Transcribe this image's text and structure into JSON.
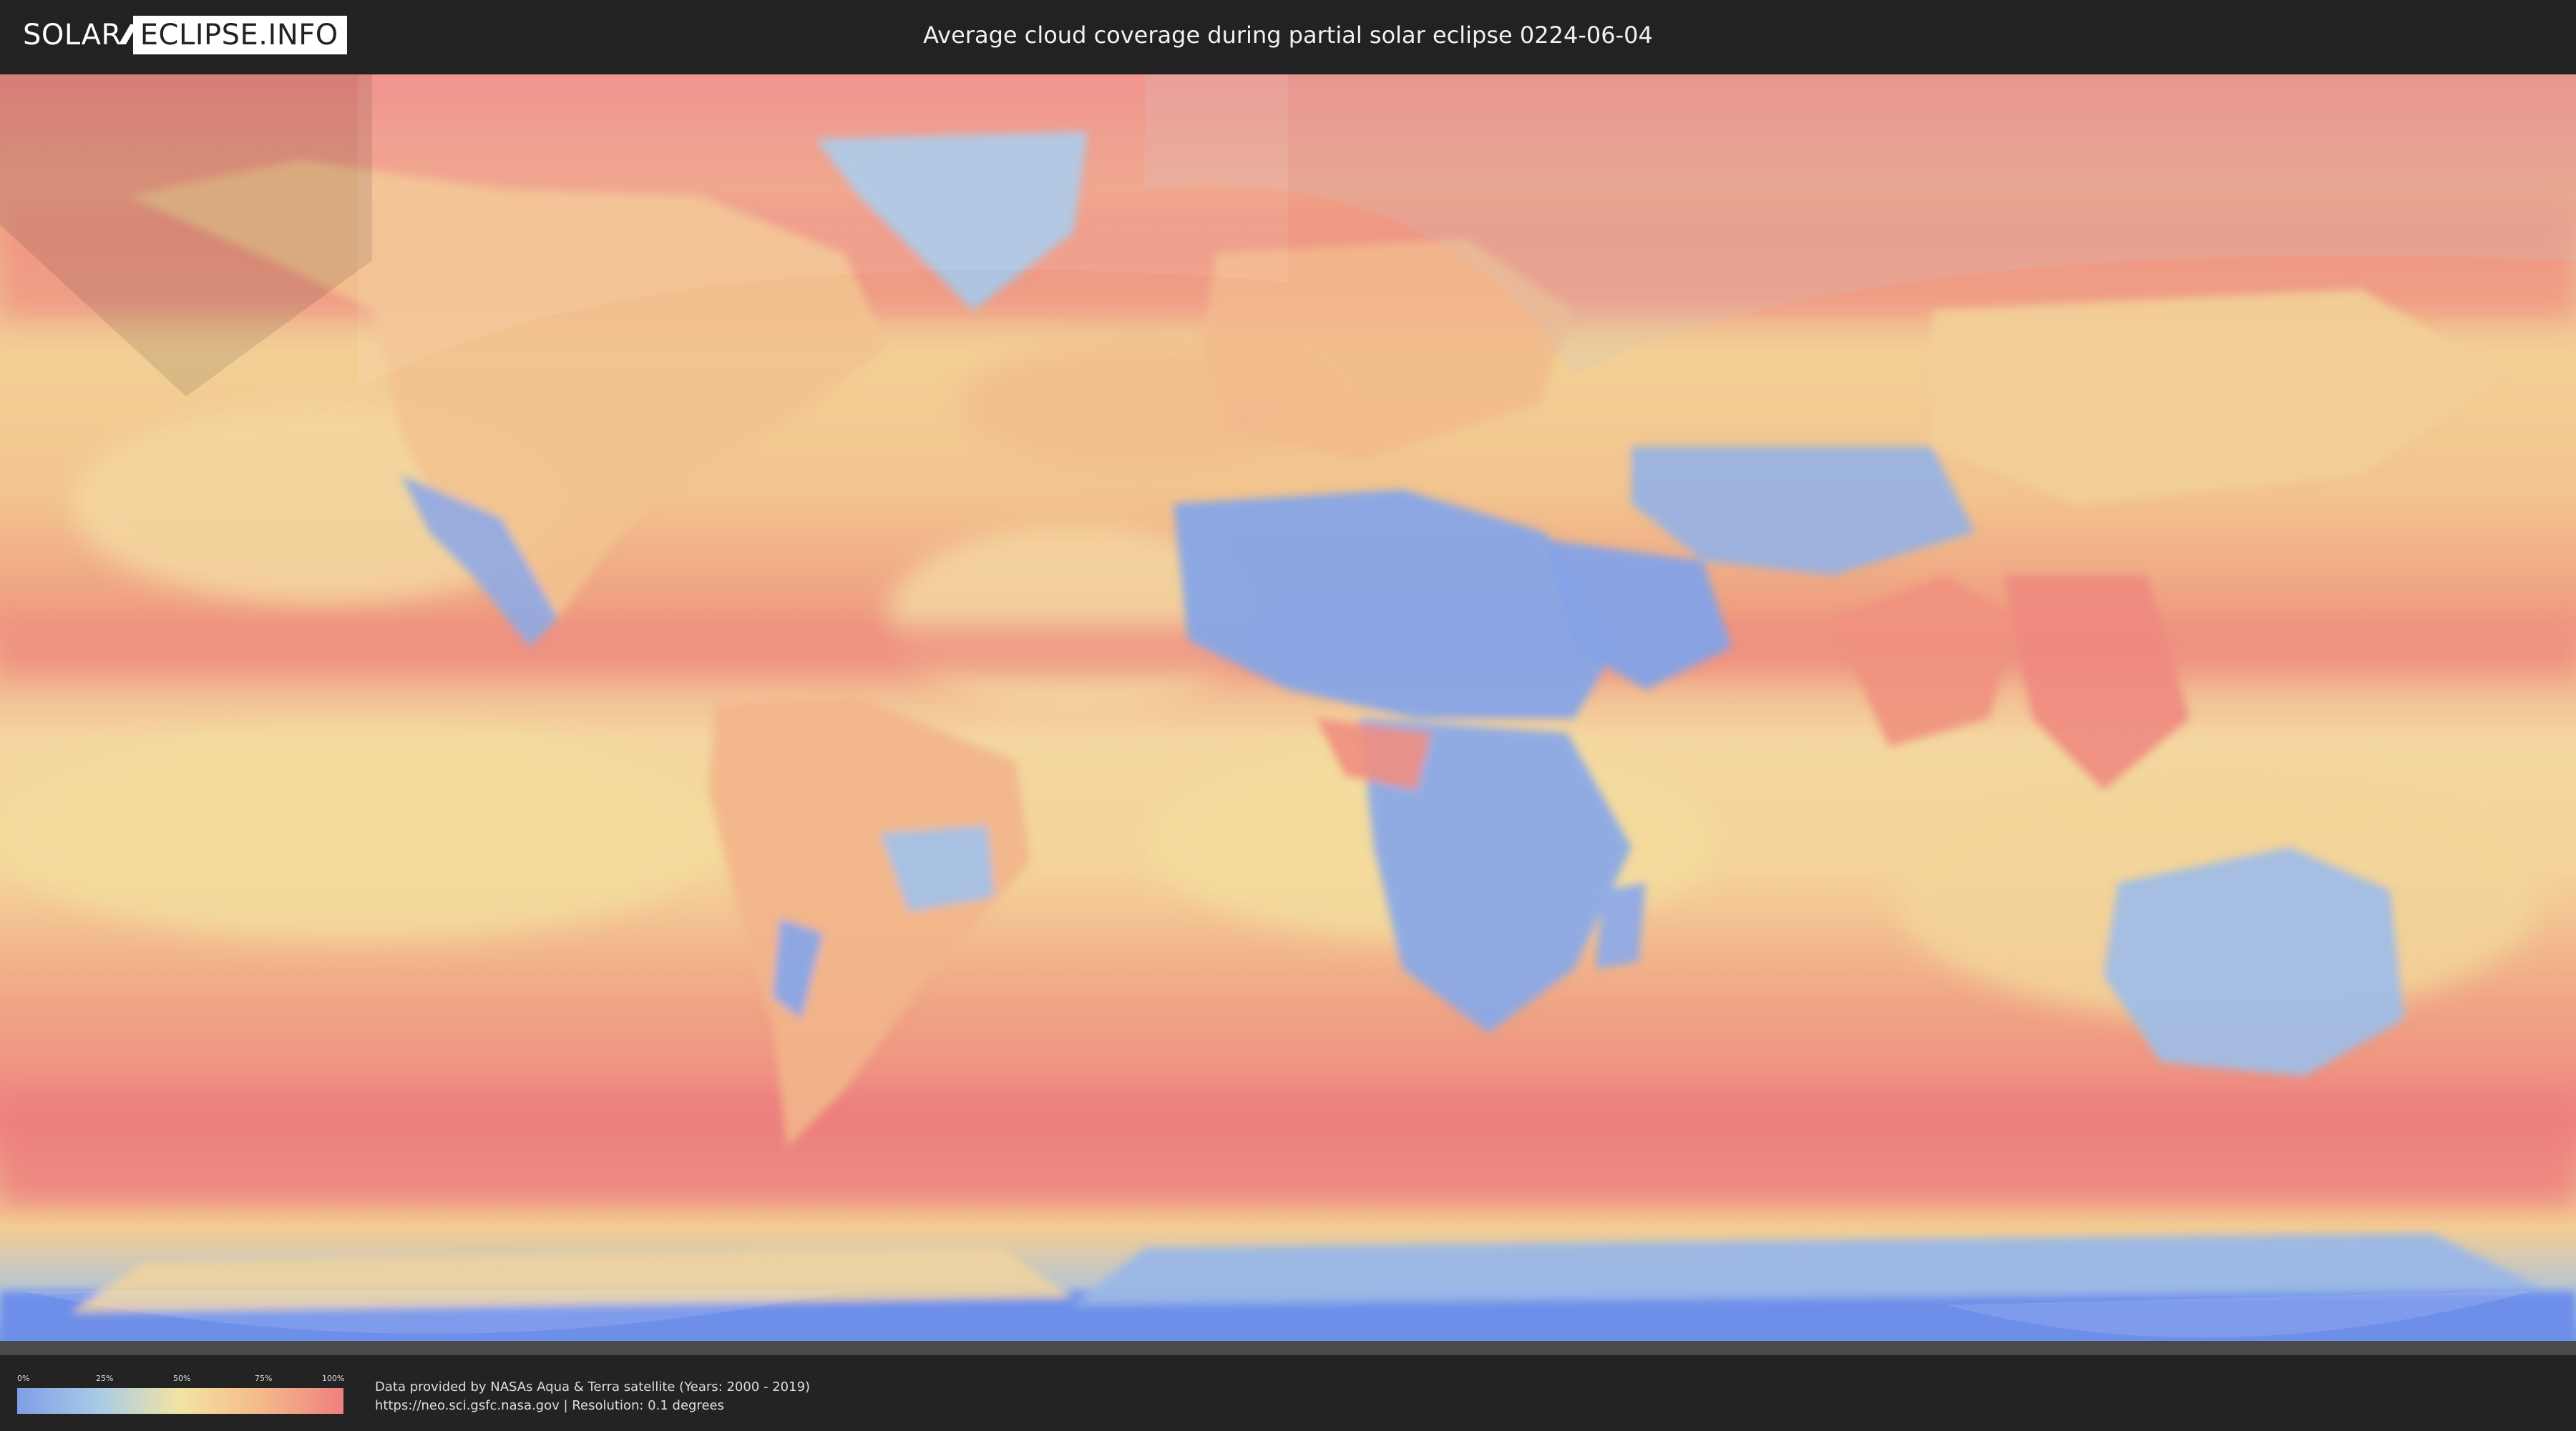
{
  "header": {
    "logo_left": "SOLAR",
    "logo_right": "ECLIPSE.INFO",
    "title": "Average cloud coverage during partial solar eclipse 0224-06-04"
  },
  "map": {
    "description_icon": "world-map-cloud-coverage",
    "colors": {
      "clear": "#7f9ee7",
      "low": "#a9cbe6",
      "mid": "#f2e3a4",
      "high": "#f4b98a",
      "overcast": "#ef7f7f"
    }
  },
  "legend": {
    "ticks": [
      "0%",
      "25%",
      "50%",
      "75%",
      "100%"
    ]
  },
  "credits": {
    "line1": "Data provided by NASAs Aqua & Terra satellite (Years: 2000 - 2019)",
    "line2": "https://neo.sci.gsfc.nasa.gov | Resolution: 0.1 degrees"
  }
}
